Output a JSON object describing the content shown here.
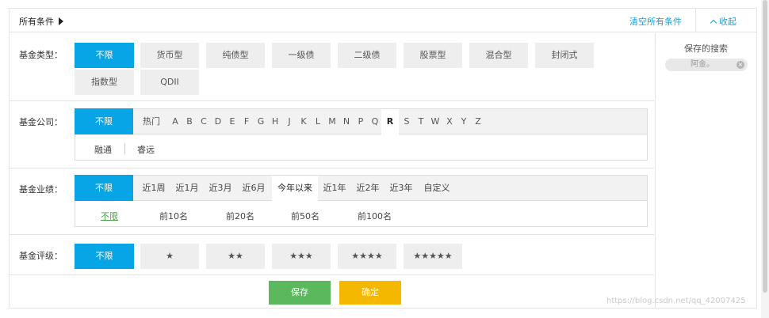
{
  "header": {
    "title": "所有条件",
    "clear_all": "清空所有条件",
    "collapse": "收起"
  },
  "saved": {
    "title": "保存的搜索",
    "chip": "阿金。"
  },
  "type_row": {
    "label": "基金类型：",
    "options": [
      "不限",
      "货币型",
      "纯债型",
      "一级债",
      "二级债",
      "股票型",
      "混合型",
      "封闭式",
      "指数型",
      "QDII"
    ]
  },
  "company_row": {
    "label": "基金公司：",
    "all": "不限",
    "letters": [
      "热门",
      "A",
      "B",
      "C",
      "D",
      "E",
      "F",
      "G",
      "H",
      "J",
      "K",
      "L",
      "M",
      "N",
      "P",
      "Q",
      "R",
      "S",
      "T",
      "W",
      "X",
      "Y",
      "Z"
    ],
    "selected_letter": "R",
    "companies": [
      "融通",
      "睿远"
    ]
  },
  "perf_row": {
    "label": "基金业绩：",
    "all": "不限",
    "periods": [
      "近1周",
      "近1月",
      "近3月",
      "近6月",
      "今年以来",
      "近1年",
      "近2年",
      "近3年",
      "自定义"
    ],
    "selected_period": "今年以来",
    "ranks": [
      "不限",
      "前10名",
      "前20名",
      "前50名",
      "前100名"
    ]
  },
  "rating_row": {
    "label": "基金评级：",
    "options": [
      "不限",
      "★",
      "★★",
      "★★★",
      "★★★★",
      "★★★★★"
    ]
  },
  "actions": {
    "save": "保存",
    "confirm": "确定"
  },
  "watermark": "https://blog.csdn.net/qq_42007425"
}
